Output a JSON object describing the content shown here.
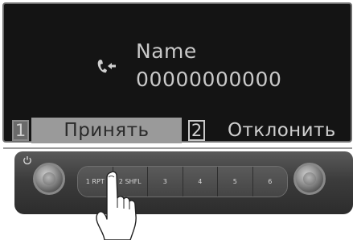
{
  "screen": {
    "caller_name": "Name",
    "caller_number": "00000000000",
    "softkeys": {
      "key1_number": "1",
      "accept_label": "Принять",
      "key2_number": "2",
      "reject_label": "Отклонить"
    }
  },
  "panel": {
    "presets": [
      "1 RPT",
      "2 SHFL",
      "3",
      "4",
      "5",
      "6"
    ]
  }
}
